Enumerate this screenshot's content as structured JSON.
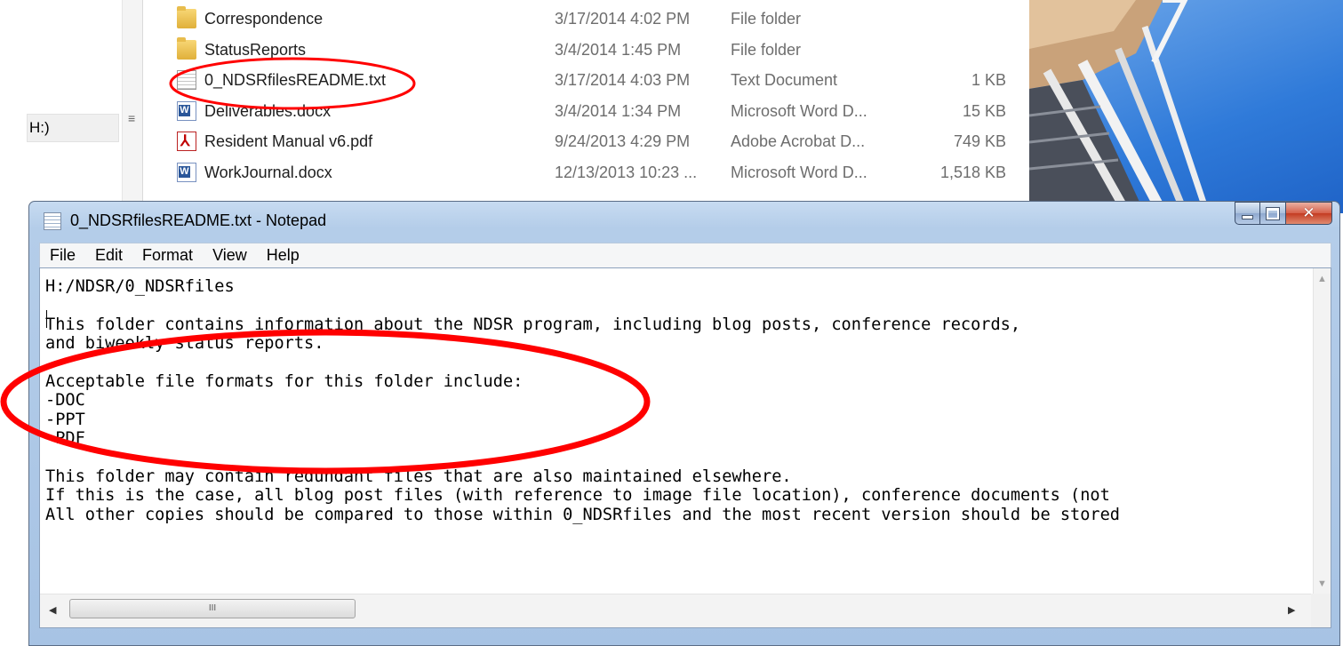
{
  "explorer": {
    "nav_drive_label": "H:)",
    "nav_grip": "≡",
    "files": [
      {
        "name": "Correspondence",
        "date": "3/17/2014 4:02 PM",
        "type": "File folder",
        "size": "",
        "icon": "folder-icon"
      },
      {
        "name": "StatusReports",
        "date": "3/4/2014 1:45 PM",
        "type": "File folder",
        "size": "",
        "icon": "folder-icon"
      },
      {
        "name": "0_NDSRfilesREADME.txt",
        "date": "3/17/2014 4:03 PM",
        "type": "Text Document",
        "size": "1 KB",
        "icon": "text-file-icon"
      },
      {
        "name": "Deliverables.docx",
        "date": "3/4/2014 1:34 PM",
        "type": "Microsoft Word D...",
        "size": "15 KB",
        "icon": "word-file-icon"
      },
      {
        "name": "Resident Manual v6.pdf",
        "date": "9/24/2013 4:29 PM",
        "type": "Adobe Acrobat D...",
        "size": "749 KB",
        "icon": "pdf-file-icon"
      },
      {
        "name": "WorkJournal.docx",
        "date": "12/13/2013 10:23 ...",
        "type": "Microsoft Word D...",
        "size": "1,518 KB",
        "icon": "word-file-icon"
      }
    ]
  },
  "notepad": {
    "title": "0_NDSRfilesREADME.txt - Notepad",
    "menu": [
      "File",
      "Edit",
      "Format",
      "View",
      "Help"
    ],
    "content_lines": [
      "H:/NDSR/0_NDSRfiles",
      "",
      "This folder contains information about the NDSR program, including blog posts, conference records,",
      "and biweekly status reports.",
      "",
      "Acceptable file formats for this folder include:",
      "-DOC",
      "-PPT",
      "-PDF",
      "",
      "This folder may contain redundant files that are also maintained elsewhere.",
      "If this is the case, all blog post files (with reference to image file location), conference documents (not",
      "All other copies should be compared to those within 0_NDSRfiles and the most recent version should be stored"
    ],
    "hscroll_thumb_grip": "III",
    "caption_buttons": {
      "minimize": "minimize-button",
      "maximize": "maximize-button",
      "close": "close-button"
    }
  },
  "annotations": {
    "color": "#ff0000"
  },
  "colors": {
    "window_frame": "#b4cde9",
    "close_button": "#c43c22",
    "sky": "#2f7ad9"
  }
}
